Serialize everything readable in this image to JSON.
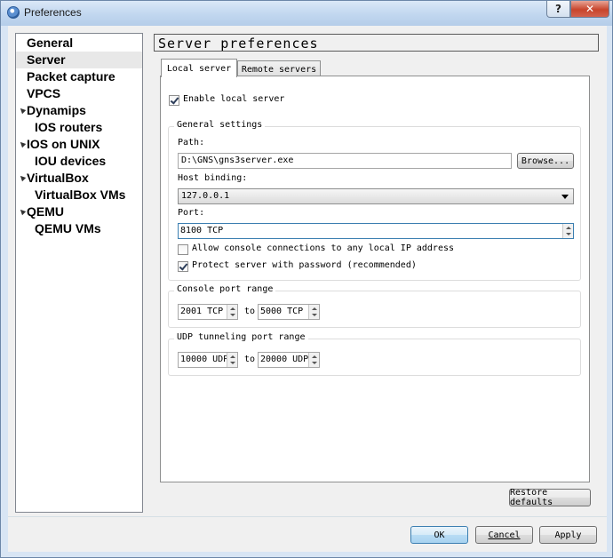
{
  "window": {
    "title": "Preferences",
    "help_label": "?",
    "close_label": "✕"
  },
  "sidebar": {
    "items": [
      {
        "label": "General"
      },
      {
        "label": "Server",
        "selected": true
      },
      {
        "label": "Packet capture"
      },
      {
        "label": "VPCS"
      },
      {
        "label": "Dynamips",
        "expanded": true
      },
      {
        "label": "IOS routers"
      },
      {
        "label": "IOS on UNIX",
        "expanded": true
      },
      {
        "label": "IOU devices"
      },
      {
        "label": "VirtualBox",
        "expanded": true
      },
      {
        "label": "VirtualBox VMs"
      },
      {
        "label": "QEMU",
        "expanded": true
      },
      {
        "label": "QEMU VMs"
      }
    ]
  },
  "panel": {
    "title": "Server preferences",
    "tabs": [
      {
        "label": "Local server",
        "active": true
      },
      {
        "label": "Remote servers",
        "active": false
      }
    ],
    "enable_local_server": {
      "label": "Enable local server",
      "checked": true
    },
    "general_settings": {
      "title": "General settings",
      "path_label": "Path:",
      "path_value": "D:\\GNS\\gns3server.exe",
      "browse_label": "Browse...",
      "host_label": "Host binding:",
      "host_value": "127.0.0.1",
      "port_label": "Port:",
      "port_value": "8100 TCP",
      "allow_console": {
        "label": "Allow console connections to any local IP address",
        "checked": false
      },
      "protect_password": {
        "label": "Protect server with password (recommended)",
        "checked": true
      }
    },
    "console_range": {
      "title": "Console port range",
      "from": "2001 TCP",
      "to_label": "to",
      "to": "5000 TCP"
    },
    "udp_range": {
      "title": "UDP tunneling port range",
      "from": "10000 UDP",
      "to_label": "to",
      "to": "20000 UDP"
    },
    "restore_label": "Restore defaults"
  },
  "footer": {
    "ok_label": "OK",
    "cancel_label": "Cancel",
    "apply_label": "Apply"
  }
}
